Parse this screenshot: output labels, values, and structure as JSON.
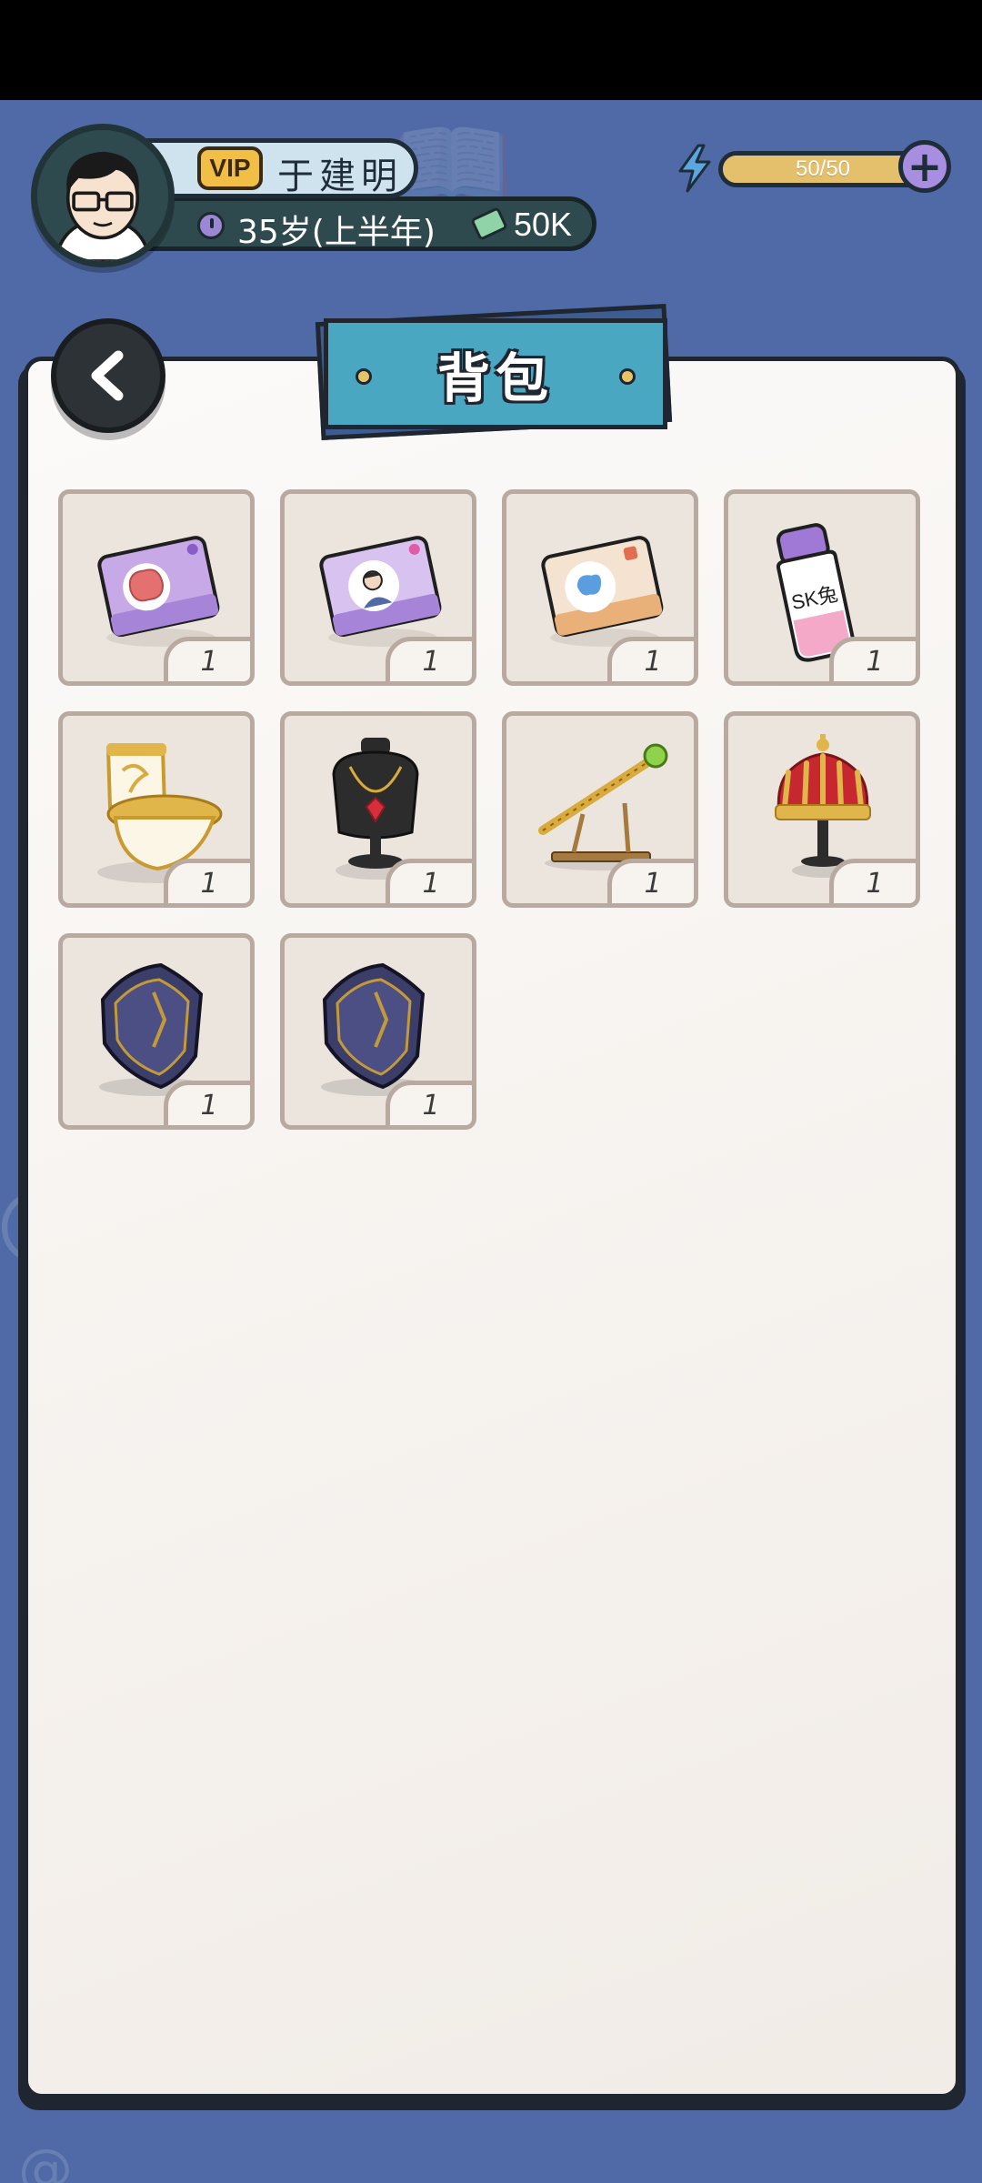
{
  "player": {
    "vip_label": "VIP",
    "name": "于建明",
    "age": "35岁(上半年)",
    "money": "50K"
  },
  "energy": {
    "current": 50,
    "max": 50,
    "label": "50/50",
    "fill_fraction": 1.0,
    "color": "#e4bf6c"
  },
  "header": {
    "add_energy_label": "+"
  },
  "panel": {
    "title": "背包"
  },
  "icons": {
    "back": "back-arrow-icon",
    "clock": "clock-icon",
    "money": "money-icon",
    "energy": "lightning-icon"
  },
  "inventory": {
    "items": [
      {
        "icon": "brain-card-icon",
        "count": "1"
      },
      {
        "icon": "portrait-card-icon",
        "count": "1"
      },
      {
        "icon": "map-card-icon",
        "count": "1"
      },
      {
        "icon": "sk-bottle-icon",
        "count": "1"
      },
      {
        "icon": "golden-toilet-icon",
        "count": "1"
      },
      {
        "icon": "ruby-necklace-icon",
        "count": "1"
      },
      {
        "icon": "golden-scepter-icon",
        "count": "1"
      },
      {
        "icon": "royal-crown-icon",
        "count": "1"
      },
      {
        "icon": "dark-shield-icon",
        "count": "1"
      },
      {
        "icon": "dark-shield-icon",
        "count": "1"
      }
    ]
  },
  "colors": {
    "background": "#4f6aa6",
    "panel": "#f7f3ef",
    "banner": "#4aa7c1",
    "vip": "#f1bf45",
    "plus_button": "#a88ee0"
  }
}
